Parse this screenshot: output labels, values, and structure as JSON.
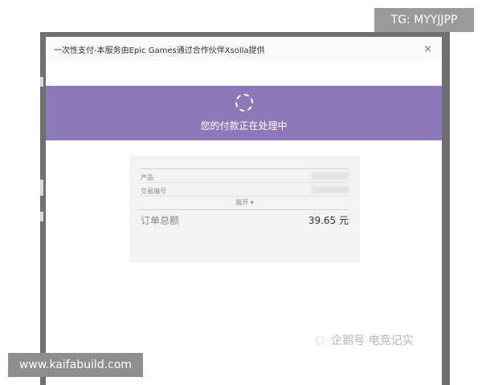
{
  "dialog": {
    "title": "一次性支付-本服务由Epic Games通过合作伙伴Xsolla提供",
    "close_glyph": "×"
  },
  "banner": {
    "status_text": "您的付款正在处理中",
    "color": "#8d79b9"
  },
  "receipt": {
    "rows": [
      {
        "label": "产品"
      },
      {
        "label": "交易编号"
      }
    ],
    "expand_label": "展开 ▾",
    "total_label": "订单总额",
    "total_value": "39.65 元"
  },
  "overlays": {
    "top_right_badge": "TG: MYYJJPP",
    "bottom_left_badge": "www.kaifabuild.com",
    "watermark_text": "企鹅号 电竞记实"
  }
}
